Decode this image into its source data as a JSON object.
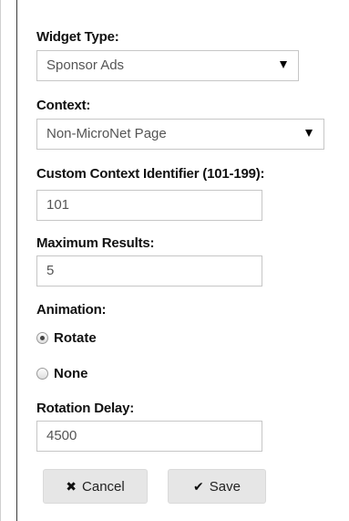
{
  "form": {
    "widget_type": {
      "label": "Widget Type:",
      "value": "Sponsor Ads"
    },
    "context": {
      "label": "Context:",
      "value": "Non-MicroNet Page"
    },
    "custom_context": {
      "label": "Custom Context Identifier (101-199):",
      "value": "101"
    },
    "maximum_results": {
      "label": "Maximum Results:",
      "value": "5"
    },
    "animation": {
      "label": "Animation:",
      "options": [
        {
          "label": "Rotate",
          "checked": true
        },
        {
          "label": "None",
          "checked": false
        }
      ]
    },
    "rotation_delay": {
      "label": "Rotation Delay:",
      "value": "4500"
    }
  },
  "actions": {
    "cancel_label": "Cancel",
    "save_label": "Save"
  },
  "icons": {
    "cancel": "times-icon",
    "save": "checkmark-icon"
  }
}
